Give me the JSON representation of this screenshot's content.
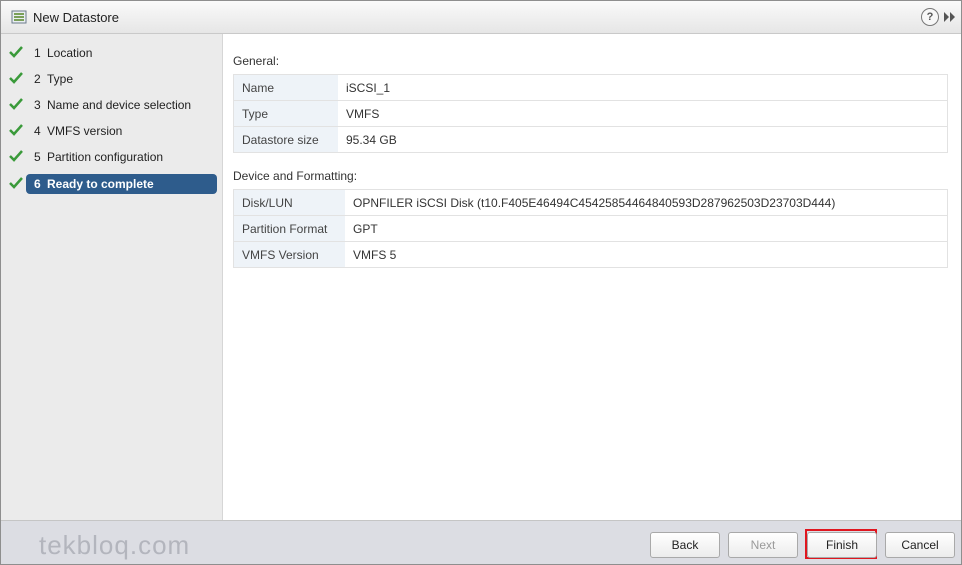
{
  "window": {
    "title": "New Datastore",
    "title_icon": "datastore-icon",
    "help_icon": "help-icon",
    "expand_icon": "expand-icon"
  },
  "steps": [
    {
      "num": "1",
      "label": "Location",
      "done": true
    },
    {
      "num": "2",
      "label": "Type",
      "done": true
    },
    {
      "num": "3",
      "label": "Name and device selection",
      "done": true
    },
    {
      "num": "4",
      "label": "VMFS version",
      "done": true
    },
    {
      "num": "5",
      "label": "Partition configuration",
      "done": true
    },
    {
      "num": "6",
      "label": "Ready to complete",
      "done": true,
      "active": true
    }
  ],
  "general": {
    "heading": "General:",
    "rows": [
      {
        "key": "Name",
        "value": "iSCSI_1"
      },
      {
        "key": "Type",
        "value": "VMFS"
      },
      {
        "key": "Datastore size",
        "value": "95.34 GB"
      }
    ]
  },
  "device": {
    "heading": "Device and Formatting:",
    "rows": [
      {
        "key": "Disk/LUN",
        "value": "OPNFILER iSCSI Disk (t10.F405E46494C45425854464840593D287962503D23703D444)"
      },
      {
        "key": "Partition Format",
        "value": "GPT"
      },
      {
        "key": "VMFS Version",
        "value": "VMFS 5"
      }
    ]
  },
  "footer": {
    "watermark": "tekbloq.com",
    "back_label": "Back",
    "next_label": "Next",
    "finish_label": "Finish",
    "cancel_label": "Cancel"
  },
  "colors": {
    "active_step": "#2e5c8c",
    "check": "#3a9a3a",
    "highlight": "#e0161f"
  }
}
